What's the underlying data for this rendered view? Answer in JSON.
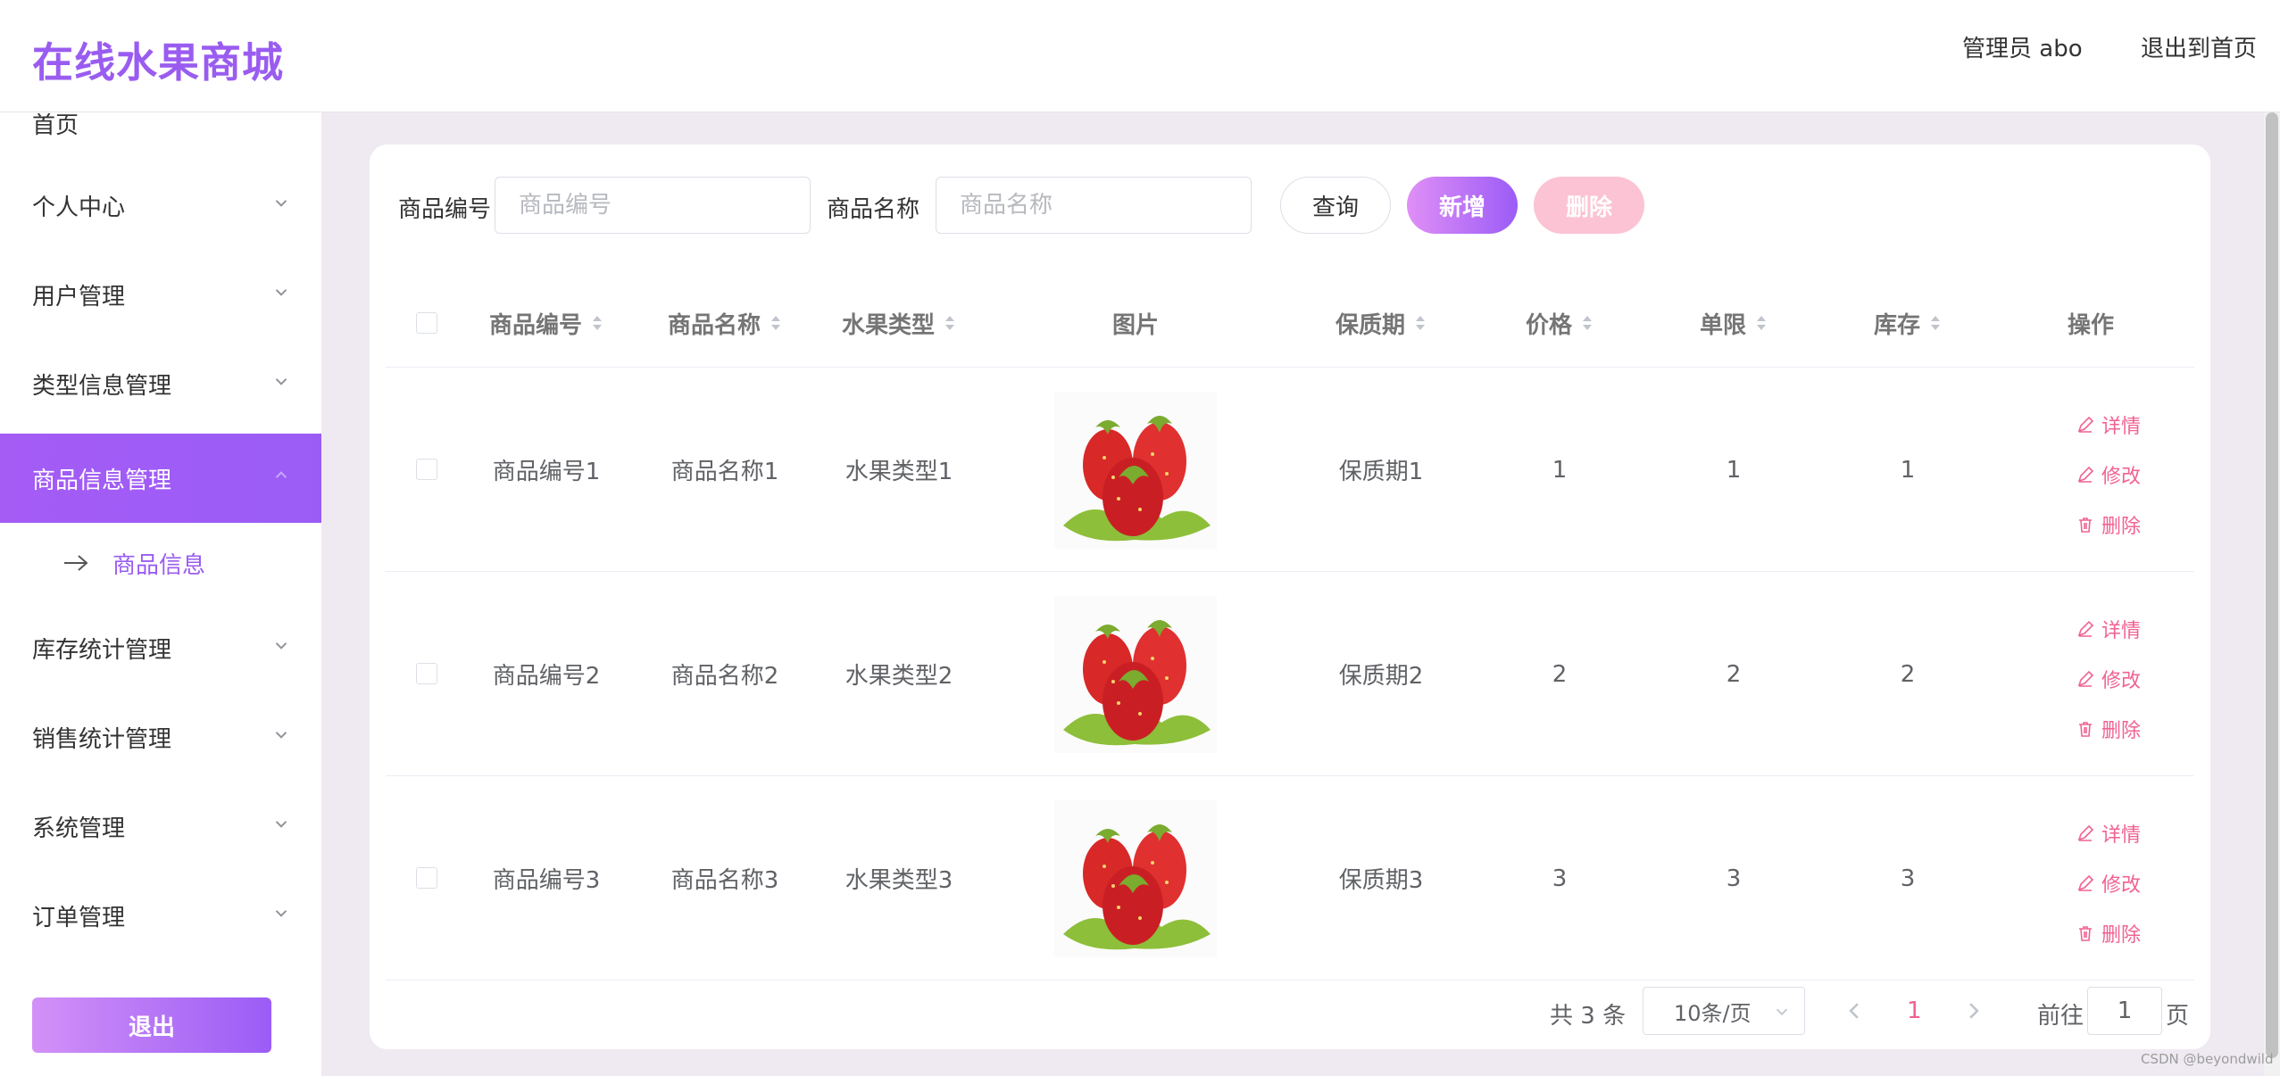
{
  "header": {
    "brand": "在线水果商城",
    "user": "管理员 abo",
    "logout_home": "退出到首页"
  },
  "sidebar": {
    "home_label": "首页",
    "items": [
      {
        "label": "个人中心",
        "expanded": false
      },
      {
        "label": "用户管理",
        "expanded": false
      },
      {
        "label": "类型信息管理",
        "expanded": false
      },
      {
        "label": "商品信息管理",
        "expanded": true,
        "active": true
      },
      {
        "label": "库存统计管理",
        "expanded": false
      },
      {
        "label": "销售统计管理",
        "expanded": false
      },
      {
        "label": "系统管理",
        "expanded": false
      },
      {
        "label": "订单管理",
        "expanded": false
      }
    ],
    "sub_item": "商品信息",
    "exit_label": "退出"
  },
  "search": {
    "code_label": "商品编号",
    "code_placeholder": "商品编号",
    "name_label": "商品名称",
    "name_placeholder": "商品名称",
    "query_label": "查询",
    "add_label": "新增",
    "delete_label": "删除"
  },
  "table": {
    "columns": [
      "商品编号",
      "商品名称",
      "水果类型",
      "图片",
      "保质期",
      "价格",
      "单限",
      "库存",
      "操作"
    ],
    "rows": [
      {
        "code": "商品编号1",
        "name": "商品名称1",
        "type": "水果类型1",
        "shelf_life": "保质期1",
        "price": "1",
        "limit": "1",
        "stock": "1"
      },
      {
        "code": "商品编号2",
        "name": "商品名称2",
        "type": "水果类型2",
        "shelf_life": "保质期2",
        "price": "2",
        "limit": "2",
        "stock": "2"
      },
      {
        "code": "商品编号3",
        "name": "商品名称3",
        "type": "水果类型3",
        "shelf_life": "保质期3",
        "price": "3",
        "limit": "3",
        "stock": "3"
      }
    ],
    "actions": {
      "detail": "详情",
      "edit": "修改",
      "delete": "删除"
    }
  },
  "pagination": {
    "total": "共 3 条",
    "page_size": "10条/页",
    "current_page": "1",
    "goto_label": "前往",
    "goto_value": "1",
    "page_suffix": "页"
  },
  "watermark": "CSDN @beyondwild",
  "colors": {
    "accent": "#9a5cf0",
    "danger": "#f06292",
    "delete_btn": "#fbc3d3"
  },
  "icons": {
    "sort": "sort-caret-icon",
    "chevron": "chevron-down-icon",
    "arrow": "arrow-right-icon",
    "edit": "edit-icon",
    "trash": "trash-icon"
  }
}
